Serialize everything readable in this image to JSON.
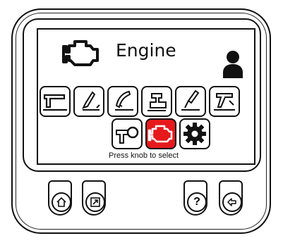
{
  "screen": {
    "title": "Engine",
    "caption": "Press knob to select"
  },
  "icons": {
    "header": "engine-icon",
    "user": "user-icon"
  },
  "menu_row1": [
    {
      "name": "tile-tig-torch"
    },
    {
      "name": "tile-mig-gun"
    },
    {
      "name": "tile-spool-gun"
    },
    {
      "name": "tile-wire-feeder"
    },
    {
      "name": "tile-stick-electrode"
    },
    {
      "name": "tile-gouging"
    }
  ],
  "menu_row2": [
    {
      "name": "tile-process-setup"
    },
    {
      "name": "tile-engine",
      "active": true
    },
    {
      "name": "tile-settings"
    }
  ],
  "buttons": {
    "help_label": "?"
  },
  "colors": {
    "active": "#e6191c",
    "outline": "#111111"
  }
}
